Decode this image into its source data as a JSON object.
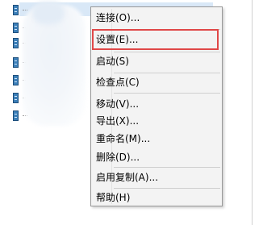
{
  "context_menu": {
    "items": [
      {
        "label": "连接(O)..."
      },
      {
        "label": "设置(E)..."
      },
      {
        "label": "启动(S)"
      },
      {
        "label": "检查点(C)"
      },
      {
        "label": "移动(V)..."
      },
      {
        "label": "导出(X)..."
      },
      {
        "label": "重命名(M)..."
      },
      {
        "label": "删除(D)..."
      },
      {
        "label": "启用复制(A)..."
      },
      {
        "label": "帮助(H)"
      }
    ]
  },
  "highlight": {
    "color": "#e04848",
    "target": "设置(E)..."
  },
  "colors": {
    "menu_background": "#f3f3f3",
    "menu_border": "#979797",
    "selection": "#d9e8f7",
    "server_icon": "#3c7fb8"
  },
  "icons": [
    "server-icon"
  ]
}
